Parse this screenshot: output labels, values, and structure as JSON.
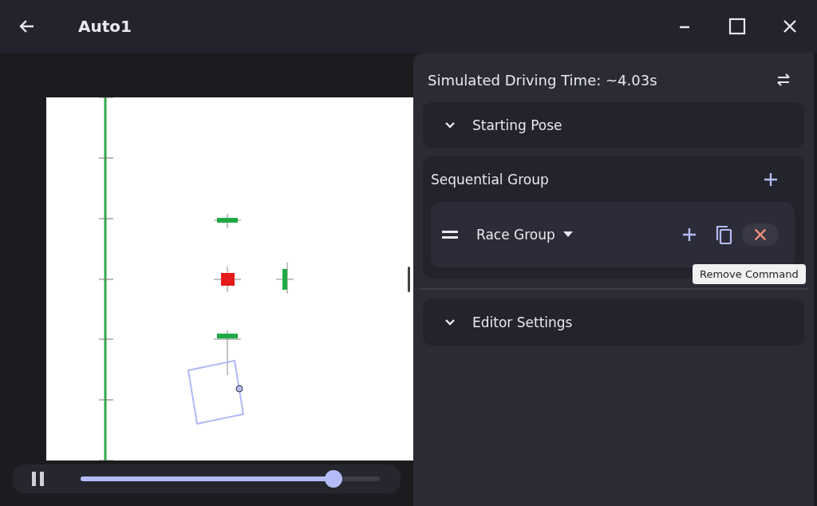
{
  "window": {
    "title": "Auto1"
  },
  "playback": {
    "playing": true,
    "level": 0.845
  },
  "panel": {
    "driving_time": "Simulated Driving Time: ~4.03s",
    "sections": [
      {
        "kind": "collapsible",
        "label": "Starting Pose",
        "expanded": false
      },
      {
        "kind": "group",
        "label": "Sequential Group",
        "commands": [
          {
            "label": "Race Group"
          }
        ]
      },
      {
        "kind": "collapsible",
        "label": "Editor Settings",
        "expanded": false
      }
    ]
  },
  "tooltip": "Remove Command"
}
